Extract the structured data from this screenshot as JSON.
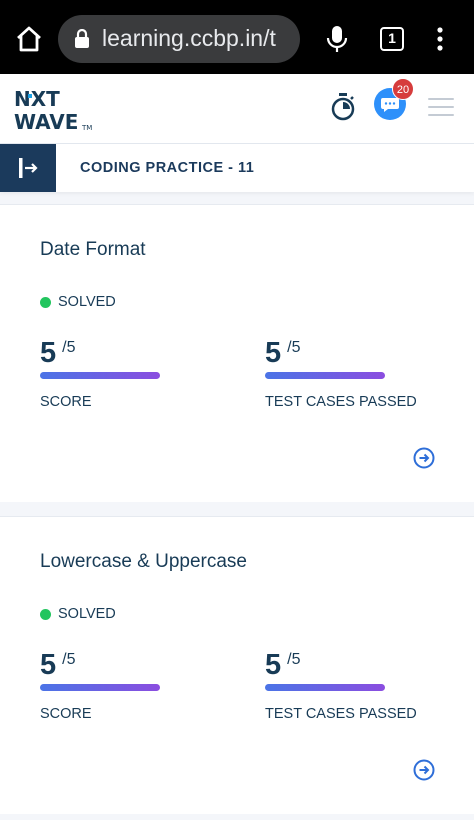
{
  "browser": {
    "url": "learning.ccbp.in/t",
    "tab_count": "1",
    "icons": [
      "home-icon",
      "lock-icon",
      "mic-icon",
      "tabs-icon",
      "more-vert-icon"
    ]
  },
  "header": {
    "logo_line1": "NXT",
    "logo_line2": "WAVE",
    "logo_tm": "TM",
    "notification_count": "20",
    "icons": [
      "timer-icon",
      "chat-icon",
      "menu-icon"
    ]
  },
  "practice": {
    "title": "CODING PRACTICE - 11"
  },
  "cards": [
    {
      "title": "Date Format",
      "status": "SOLVED",
      "score": "5",
      "score_total": "/5",
      "score_label": "SCORE",
      "tests": "5",
      "tests_total": "/5",
      "tests_label": "TEST CASES PASSED"
    },
    {
      "title": "Lowercase & Uppercase",
      "status": "SOLVED",
      "score": "5",
      "score_total": "/5",
      "score_label": "SCORE",
      "tests": "5",
      "tests_total": "/5",
      "tests_label": "TEST CASES PASSED"
    }
  ],
  "colors": {
    "primary": "#1b3a5c",
    "solved": "#22c55e",
    "bar_start": "#4b74e6",
    "bar_end": "#8b4de0",
    "badge": "#d63c3c"
  }
}
